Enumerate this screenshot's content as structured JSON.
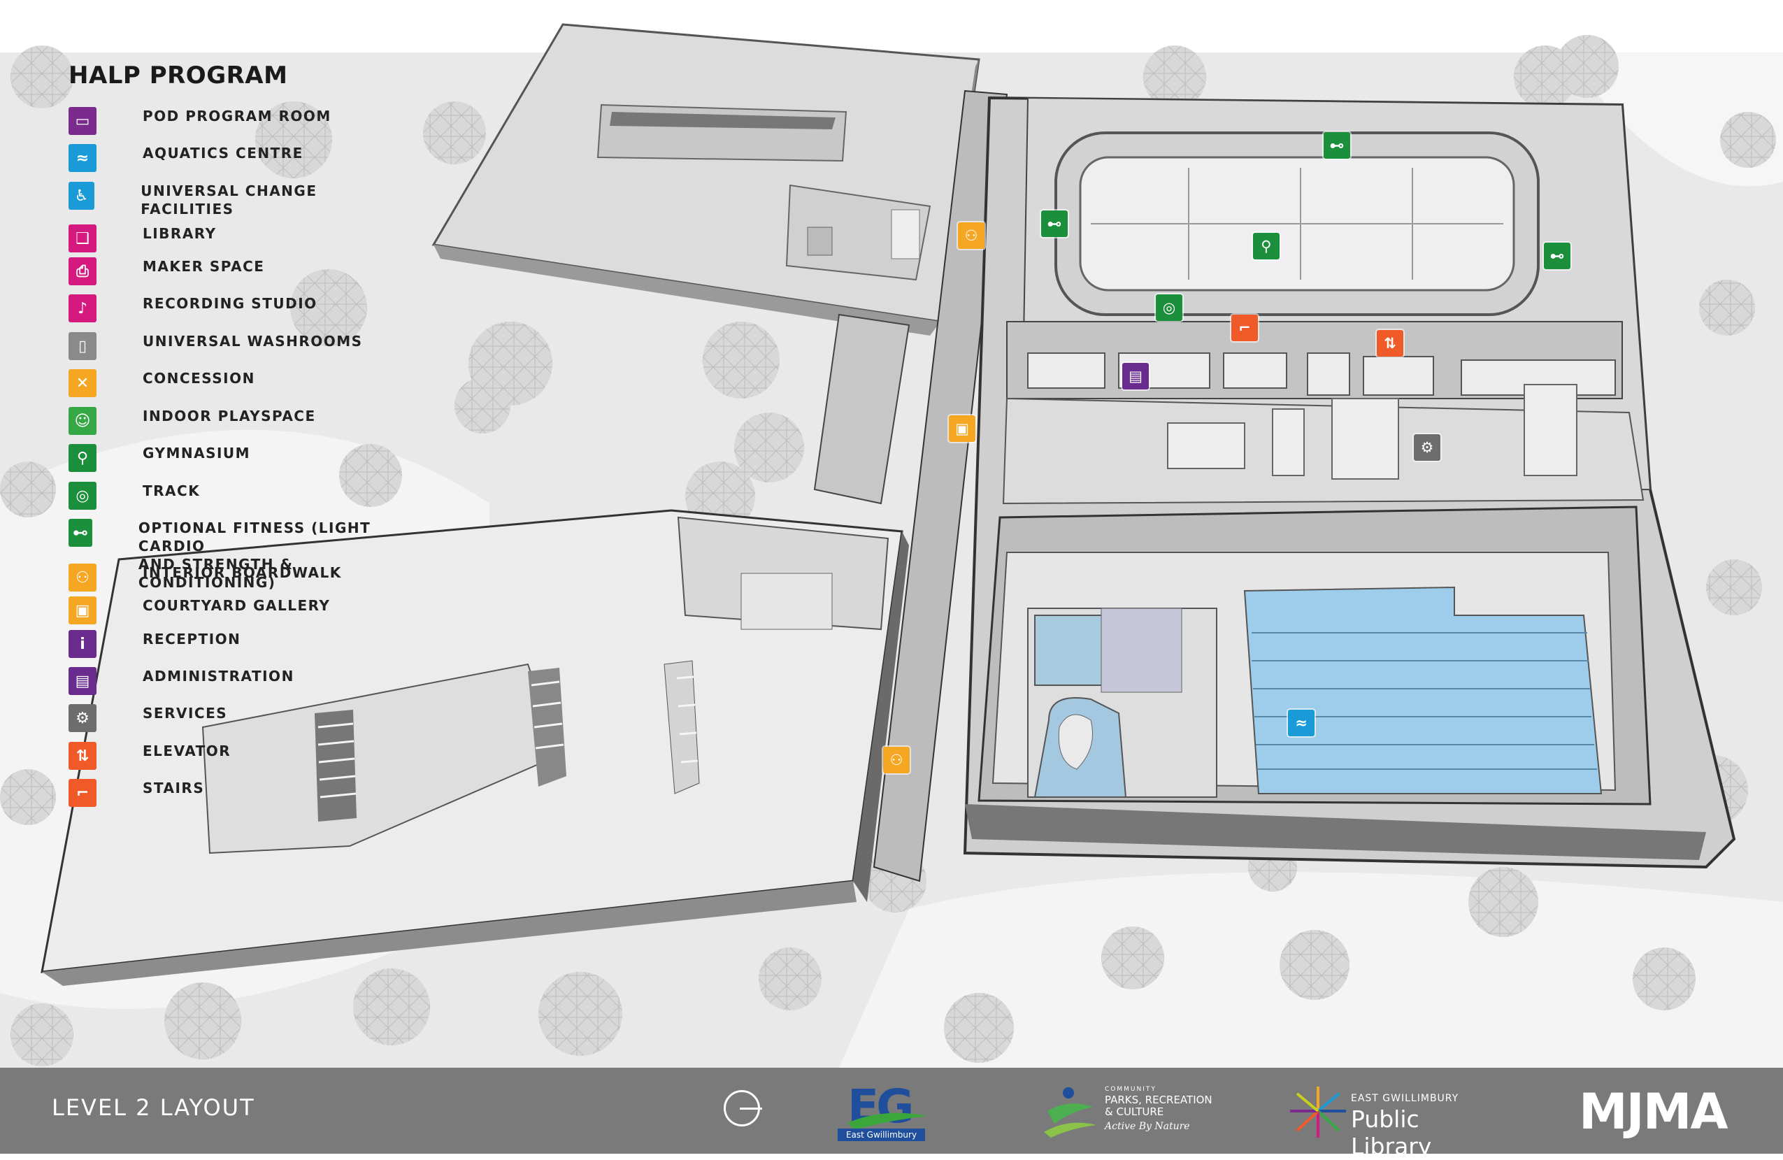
{
  "legend": {
    "title": "HALP PROGRAM",
    "items": [
      {
        "label": "POD PROGRAM ROOM",
        "color": "#7b2b8e",
        "icon": "chat-bubbles-icon",
        "glyph": "▭"
      },
      {
        "label": "AQUATICS CENTRE",
        "color": "#1a9ad6",
        "icon": "swimmer-icon",
        "glyph": "≈"
      },
      {
        "label": "UNIVERSAL CHANGE FACILITIES",
        "color": "#1a9ad6",
        "icon": "accessible-icon",
        "glyph": "♿"
      },
      {
        "label": "LIBRARY",
        "color": "#d6197e",
        "icon": "open-book-icon",
        "glyph": "❑"
      },
      {
        "label": "MAKER SPACE",
        "color": "#d6197e",
        "icon": "printer-icon",
        "glyph": "⎙"
      },
      {
        "label": "RECORDING STUDIO",
        "color": "#d6197e",
        "icon": "guitar-icon",
        "glyph": "♪"
      },
      {
        "label": "UNIVERSAL WASHROOMS",
        "color": "#8a8a8a",
        "icon": "toilet-icon",
        "glyph": "▯"
      },
      {
        "label": "CONCESSION",
        "color": "#f5a623",
        "icon": "fork-knife-icon",
        "glyph": "✕"
      },
      {
        "label": "INDOOR PLAYSPACE",
        "color": "#35a845",
        "icon": "children-icon",
        "glyph": "☺"
      },
      {
        "label": "GYMNASIUM",
        "color": "#1c8f3c",
        "icon": "runner-icon",
        "glyph": "⚲"
      },
      {
        "label": "TRACK",
        "color": "#1c8f3c",
        "icon": "track-icon",
        "glyph": "◎"
      },
      {
        "label": "OPTIONAL FITNESS (LIGHT CARDIO\nAND STRENGTH & CONDITIONING)",
        "color": "#1c8f3c",
        "icon": "dumbbell-icon",
        "glyph": "⊷"
      },
      {
        "label": "INTERIOR BOARDWALK",
        "color": "#f5a623",
        "icon": "people-icon",
        "glyph": "⚇"
      },
      {
        "label": "COURTYARD GALLERY",
        "color": "#f5a623",
        "icon": "gallery-icon",
        "glyph": "▣"
      },
      {
        "label": "RECEPTION",
        "color": "#6a2b8e",
        "icon": "info-icon",
        "glyph": "i"
      },
      {
        "label": "ADMINISTRATION",
        "color": "#6a2b8e",
        "icon": "admin-desk-icon",
        "glyph": "▤"
      },
      {
        "label": "SERVICES",
        "color": "#6d6d6d",
        "icon": "gears-icon",
        "glyph": "⚙"
      },
      {
        "label": "ELEVATOR",
        "color": "#f05a28",
        "icon": "elevator-icon",
        "glyph": "⇅"
      },
      {
        "label": "STAIRS",
        "color": "#f05a28",
        "icon": "stairs-icon",
        "glyph": "⌐"
      }
    ]
  },
  "map_markers": [
    {
      "name": "marker-optional-fitness-north",
      "icon": "dumbbell-icon",
      "color": "#1c8f3c",
      "glyph": "⊷"
    },
    {
      "name": "marker-optional-fitness-west",
      "icon": "dumbbell-icon",
      "color": "#1c8f3c",
      "glyph": "⊷"
    },
    {
      "name": "marker-optional-fitness-east",
      "icon": "dumbbell-icon",
      "color": "#1c8f3c",
      "glyph": "⊷"
    },
    {
      "name": "marker-gymnasium",
      "icon": "runner-icon",
      "color": "#1c8f3c",
      "glyph": "⚲"
    },
    {
      "name": "marker-track",
      "icon": "track-icon",
      "color": "#1c8f3c",
      "glyph": "◎"
    },
    {
      "name": "marker-stairs",
      "icon": "stairs-icon",
      "color": "#f05a28",
      "glyph": "⌐"
    },
    {
      "name": "marker-elevator",
      "icon": "elevator-icon",
      "color": "#f05a28",
      "glyph": "⇅"
    },
    {
      "name": "marker-administration",
      "icon": "admin-desk-icon",
      "color": "#6a2b8e",
      "glyph": "▤"
    },
    {
      "name": "marker-services",
      "icon": "gears-icon",
      "color": "#6d6d6d",
      "glyph": "⚙"
    },
    {
      "name": "marker-interior-boardwalk-north",
      "icon": "people-icon",
      "color": "#f5a623",
      "glyph": "⚇"
    },
    {
      "name": "marker-courtyard-gallery",
      "icon": "gallery-icon",
      "color": "#f5a623",
      "glyph": "▣"
    },
    {
      "name": "marker-interior-boardwalk-south",
      "icon": "people-icon",
      "color": "#f5a623",
      "glyph": "⚇"
    },
    {
      "name": "marker-aquatics-centre",
      "icon": "swimmer-icon",
      "color": "#1a9ad6",
      "glyph": "≈"
    }
  ],
  "footer": {
    "title": "LEVEL 2 LAYOUT",
    "logos": {
      "eg_letters": "EG",
      "eg_name": "East Gwillimbury",
      "parks_small": "COMMUNITY",
      "parks_main": "PARKS, RECREATION\n& CULTURE",
      "parks_tagline": "Active By Nature",
      "library_small": "EAST GWILLIMBURY",
      "library_main": "Public Library",
      "mjma": "MJMA"
    }
  },
  "colors": {
    "footer_bg": "#7a7a7a",
    "pool_water": "#8fc7e8",
    "tree": "#d9d9d9",
    "roof": "#f2f2f2"
  }
}
